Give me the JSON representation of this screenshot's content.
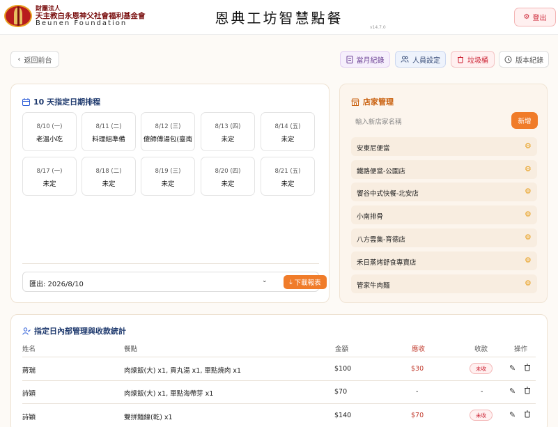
{
  "header": {
    "org_line1": "財團法人",
    "org_line2": "天主教白永恩神父社會福利基金會",
    "org_line3": "Beunen Foundation",
    "app_title": "恩典工坊智慧點餐",
    "version": "v14.7.0",
    "logout_label": "登出"
  },
  "nav": {
    "back_label": "返回前台",
    "monthly_label": "當月紀錄",
    "staff_label": "人員設定",
    "trash_label": "垃圾桶",
    "versions_label": "版本紀錄"
  },
  "schedule": {
    "title": "10 天指定日期排程",
    "days": [
      {
        "date": "8/10 (一)",
        "name": "老溫小吃"
      },
      {
        "date": "8/11 (二)",
        "name": "料理組準備"
      },
      {
        "date": "8/12 (三)",
        "name": "傻師傅湯包(臺南"
      },
      {
        "date": "8/13 (四)",
        "name": "未定"
      },
      {
        "date": "8/14 (五)",
        "name": "未定"
      },
      {
        "date": "8/17 (一)",
        "name": "未定"
      },
      {
        "date": "8/18 (二)",
        "name": "未定"
      },
      {
        "date": "8/19 (三)",
        "name": "未定"
      },
      {
        "date": "8/20 (四)",
        "name": "未定"
      },
      {
        "date": "8/21 (五)",
        "name": "未定"
      }
    ],
    "export_label": "匯出: 2026/8/10",
    "download_label": "下載報表"
  },
  "stores": {
    "title": "店家管理",
    "new_placeholder": "輸入新店家名稱",
    "add_label": "新增",
    "items": [
      "安東尼便當",
      "鐵路便當-公園店",
      "饗谷中式快餐-北安店",
      "小南排骨",
      "八方雲集-育德店",
      "禾日蒸烤舒食專賣店",
      "管家牛肉麵"
    ]
  },
  "orders": {
    "title": "指定日內部管理與收款統計",
    "headers": {
      "name": "姓名",
      "meal": "餐點",
      "amount": "金額",
      "due": "應收",
      "collected": "收款",
      "actions": "操作"
    },
    "rows": [
      {
        "name": "蔣瑞",
        "meal": "肉燥飯(大) x1, 貢丸湯 x1, 單點燒肉 x1",
        "amount": "$100",
        "due": "$30",
        "collected": "未收"
      },
      {
        "name": "詩穎",
        "meal": "肉燥飯(大) x1, 單點海帶芽 x1",
        "amount": "$70",
        "due": "-",
        "collected": "-"
      },
      {
        "name": "詩穎",
        "meal": "雙拼麵線(乾) x1",
        "amount": "$140",
        "due": "$70",
        "collected": "未收"
      }
    ]
  },
  "colors": {
    "accent": "#f07c2a",
    "danger": "#c0392b",
    "navy": "#1f3a6e",
    "background": "#fdfaf6"
  }
}
